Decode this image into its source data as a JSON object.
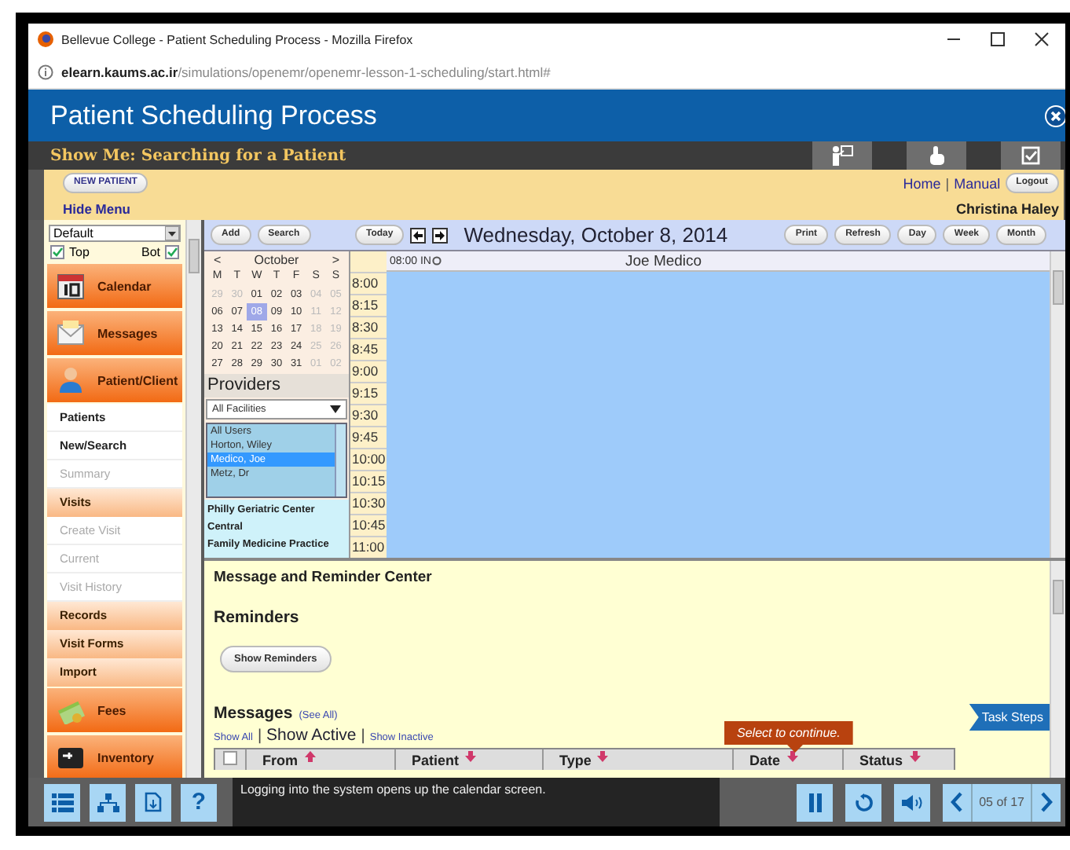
{
  "browser": {
    "title": "Bellevue College - Patient Scheduling Process - Mozilla Firefox",
    "url_host": "elearn.kaums.ac.ir",
    "url_path": "/simulations/openemr/openemr-lesson-1-scheduling/start.html#"
  },
  "lesson": {
    "title": "Patient Scheduling Process",
    "subtitle": "Show Me: Searching for a Patient"
  },
  "top_bar": {
    "new_patient": "NEW PATIENT",
    "hide_menu": "Hide Menu",
    "links": [
      "Home",
      "Manual"
    ],
    "separator": "|",
    "logout": "Logout",
    "user": "Christina Haley"
  },
  "sidebar": {
    "view": "Default",
    "checks": [
      {
        "label": "Top",
        "checked": true
      },
      {
        "label": "Bot",
        "checked": true
      }
    ],
    "items": [
      {
        "label": "Calendar",
        "kind": "module"
      },
      {
        "label": "Messages",
        "kind": "module"
      },
      {
        "label": "Patient/Client",
        "kind": "module"
      },
      {
        "label": "Patients",
        "kind": "link"
      },
      {
        "label": "New/Search",
        "kind": "link"
      },
      {
        "label": "Summary",
        "kind": "disabled"
      },
      {
        "label": "Visits",
        "kind": "section"
      },
      {
        "label": "Create Visit",
        "kind": "disabled"
      },
      {
        "label": "Current",
        "kind": "disabled"
      },
      {
        "label": "Visit History",
        "kind": "disabled"
      },
      {
        "label": "Records",
        "kind": "section"
      },
      {
        "label": "Visit Forms",
        "kind": "section"
      },
      {
        "label": "Import",
        "kind": "section"
      },
      {
        "label": "Fees",
        "kind": "module"
      },
      {
        "label": "Inventory",
        "kind": "module"
      }
    ]
  },
  "calendar": {
    "buttons": [
      "Add",
      "Search"
    ],
    "today": "Today",
    "date": "Wednesday, October 8, 2014",
    "views": [
      "Print",
      "Refresh",
      "Day",
      "Week",
      "Month"
    ],
    "month": "October",
    "prev": "<",
    "next": ">",
    "weekdays": [
      "M",
      "T",
      "W",
      "T",
      "F",
      "S",
      "S"
    ],
    "weeks": [
      [
        {
          "day": "29",
          "muted": true,
          "selected": false
        },
        {
          "day": "30",
          "muted": true,
          "selected": false
        },
        {
          "day": "01",
          "muted": false,
          "selected": false
        },
        {
          "day": "02",
          "muted": false,
          "selected": false
        },
        {
          "day": "03",
          "muted": false,
          "selected": false
        },
        {
          "day": "04",
          "muted": true,
          "selected": false
        },
        {
          "day": "05",
          "muted": true,
          "selected": false
        }
      ],
      [
        {
          "day": "06",
          "muted": false,
          "selected": false
        },
        {
          "day": "07",
          "muted": false,
          "selected": false
        },
        {
          "day": "08",
          "muted": false,
          "selected": true
        },
        {
          "day": "09",
          "muted": false,
          "selected": false
        },
        {
          "day": "10",
          "muted": false,
          "selected": false
        },
        {
          "day": "11",
          "muted": true,
          "selected": false
        },
        {
          "day": "12",
          "muted": true,
          "selected": false
        }
      ],
      [
        {
          "day": "13",
          "muted": false,
          "selected": false
        },
        {
          "day": "14",
          "muted": false,
          "selected": false
        },
        {
          "day": "15",
          "muted": false,
          "selected": false
        },
        {
          "day": "16",
          "muted": false,
          "selected": false
        },
        {
          "day": "17",
          "muted": false,
          "selected": false
        },
        {
          "day": "18",
          "muted": true,
          "selected": false
        },
        {
          "day": "19",
          "muted": true,
          "selected": false
        }
      ],
      [
        {
          "day": "20",
          "muted": false,
          "selected": false
        },
        {
          "day": "21",
          "muted": false,
          "selected": false
        },
        {
          "day": "22",
          "muted": false,
          "selected": false
        },
        {
          "day": "23",
          "muted": false,
          "selected": false
        },
        {
          "day": "24",
          "muted": false,
          "selected": false
        },
        {
          "day": "25",
          "muted": true,
          "selected": false
        },
        {
          "day": "26",
          "muted": true,
          "selected": false
        }
      ],
      [
        {
          "day": "27",
          "muted": false,
          "selected": false
        },
        {
          "day": "28",
          "muted": false,
          "selected": false
        },
        {
          "day": "29",
          "muted": false,
          "selected": false
        },
        {
          "day": "30",
          "muted": false,
          "selected": false
        },
        {
          "day": "31",
          "muted": false,
          "selected": false
        },
        {
          "day": "01",
          "muted": true,
          "selected": false
        },
        {
          "day": "02",
          "muted": true,
          "selected": false
        }
      ]
    ],
    "providers_title": "Providers",
    "facility_filter": "All Facilities",
    "providers": [
      {
        "name": "All Users",
        "selected": false
      },
      {
        "name": "Horton, Wiley",
        "selected": false
      },
      {
        "name": "Medico, Joe",
        "selected": true
      },
      {
        "name": "Metz, Dr",
        "selected": false
      }
    ],
    "facilities": [
      "Philly Geriatric Center",
      "Central",
      "Family Medicine Practice"
    ],
    "slot_header": "08:00 IN",
    "provider_column": "Joe Medico",
    "times": [
      "8:00",
      "8:15",
      "8:30",
      "8:45",
      "9:00",
      "9:15",
      "9:30",
      "9:45",
      "10:00",
      "10:15",
      "10:30",
      "10:45",
      "11:00"
    ]
  },
  "message_center": {
    "title": "Message and Reminder Center",
    "reminders_title": "Reminders",
    "show_reminders": "Show Reminders",
    "messages_title": "Messages",
    "see_all": "(See All)",
    "filters": [
      {
        "label": "Show All",
        "selected": false
      },
      {
        "label": "Show Active",
        "selected": true
      },
      {
        "label": "Show Inactive",
        "selected": false
      }
    ],
    "filter_separator": "|",
    "select_all": {
      "checked": false
    },
    "columns": [
      "From",
      "Patient",
      "Type",
      "Date",
      "Status"
    ]
  },
  "task_steps": "Task Steps",
  "tooltip": "Select to continue.",
  "player": {
    "help": "?",
    "caption": "Logging into the system opens up the calendar screen.",
    "page": "05 of 17"
  }
}
